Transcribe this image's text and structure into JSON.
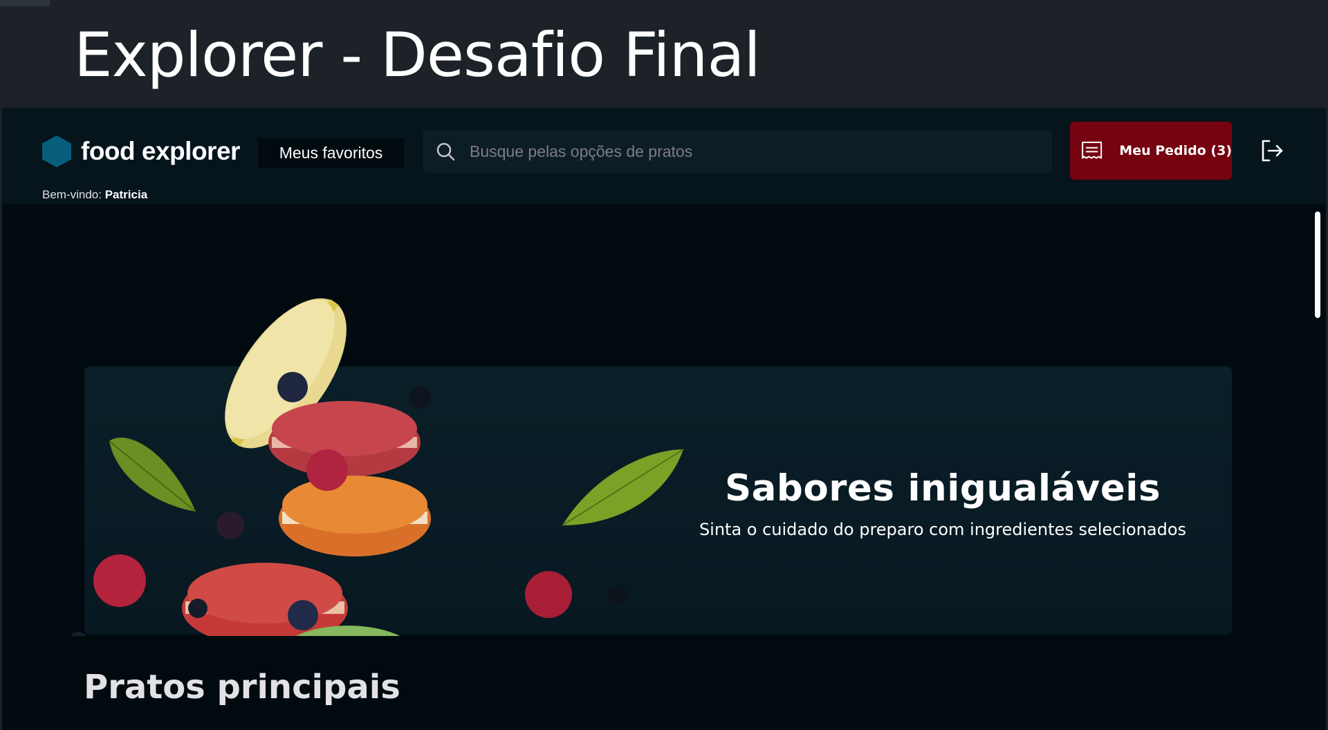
{
  "window": {
    "title": "Explorer - Desafio Final"
  },
  "header": {
    "logo_text": "food explorer",
    "favorites_label": "Meus favoritos",
    "search": {
      "placeholder": "Busque pelas opções de pratos",
      "value": ""
    },
    "order_button_label": "Meu Pedido (3)",
    "welcome_prefix": "Bem-vindo:",
    "welcome_user": "Patricia"
  },
  "banner": {
    "title": "Sabores inigualáveis",
    "subtitle": "Sinta o cuidado do preparo com ingredientes selecionados"
  },
  "sections": [
    {
      "title": "Pratos principais"
    }
  ],
  "icons": {
    "logo": "hexagon-icon",
    "search": "search-icon",
    "order": "receipt-icon",
    "logout": "sign-out-icon"
  },
  "colors": {
    "logo_hex": "#065e7c",
    "order_button": "#750310",
    "app_background": "#000a0f",
    "header_background": "#06141c",
    "banner_background": "#0a1f28",
    "window_background": "#1c2228"
  }
}
